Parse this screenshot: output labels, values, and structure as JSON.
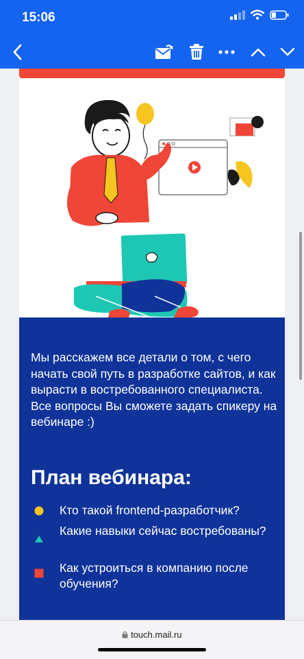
{
  "status_bar": {
    "time": "15:06"
  },
  "toolbar": {
    "back_icon": "chevron-left-icon",
    "actions": [
      "mark-unread-icon",
      "trash-icon",
      "more-icon",
      "chevron-up-icon",
      "chevron-down-icon"
    ]
  },
  "email": {
    "intro_text": "Мы расскажем все детали о том, с чего начать свой путь в разработке сайтов, и как вырасти в востребованного специалиста. Все вопросы Вы сможете задать спикеру на вебинаре :)",
    "plan_heading": "План вебинара:",
    "plan_items": [
      {
        "text": "Кто такой frontend-разработчик?",
        "bullet": "circle",
        "color": "#f7c51f"
      },
      {
        "text": "Какие навыки сейчас востребованы?",
        "bullet": "triangle",
        "color": "#1ec7b4"
      },
      {
        "text": "Как устроиться в компанию после обучения?",
        "bullet": "square",
        "color": "#ef4637"
      }
    ]
  },
  "colors": {
    "header_blue": "#1464f0",
    "email_blue": "#0f3399",
    "accent_red": "#ef4637"
  },
  "browser": {
    "url": "touch.mail.ru"
  }
}
